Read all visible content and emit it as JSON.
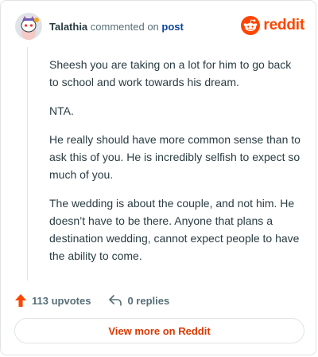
{
  "header": {
    "author": "Talathia",
    "action_text": "commented on",
    "post_link": "post",
    "brand": "reddit"
  },
  "comment": {
    "paragraphs": [
      "Sheesh you are taking on a lot for him to go back to school and work towards his dream.",
      "NTA.",
      "He really should have more common sense than to ask this of you. He is incredibly selfish to expect so much of you.",
      "The wedding is about the couple, and not him. He doesn’t have to be there. Anyone that plans a destination wedding, cannot expect people to have the ability to come."
    ]
  },
  "footer": {
    "upvotes": "113 upvotes",
    "replies": "0 replies"
  },
  "cta": {
    "label": "View more on Reddit"
  },
  "colors": {
    "brand_orange": "#ff4500",
    "cta_text": "#d93900",
    "link_blue": "#0a449b"
  },
  "icons": {
    "avatar": "snoo-avatar-icon",
    "brand": "reddit-logo-icon",
    "upvote": "upvote-arrow-icon",
    "reply": "reply-arrow-icon"
  }
}
